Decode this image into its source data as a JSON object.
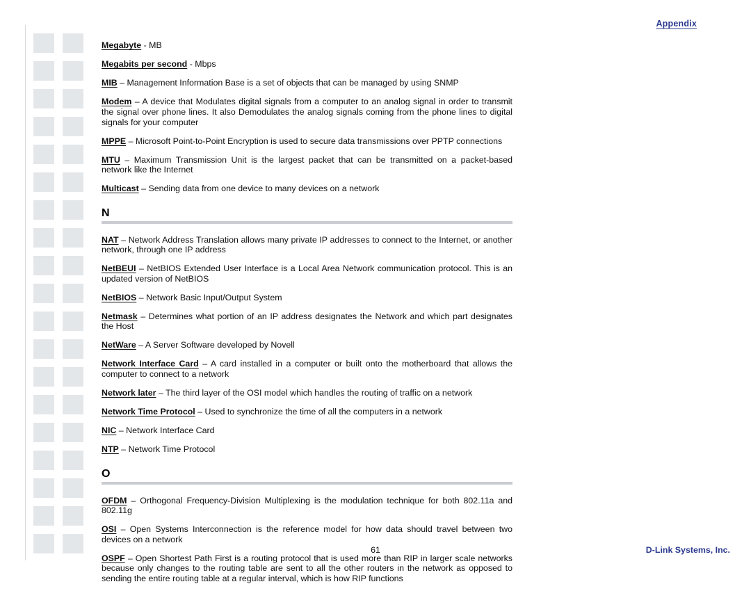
{
  "header": {
    "appendix_label": "Appendix"
  },
  "footer": {
    "page_number": "61",
    "brand": "D-Link Systems, Inc."
  },
  "decor": {
    "square_color": "#e4e7ea",
    "rule_color": "#c9ccd0",
    "accent_color": "#2b3a8f",
    "square_rows": 19
  },
  "glossary": {
    "entries_top": [
      {
        "term": "Megabyte",
        "definition": " - MB"
      },
      {
        "term": "Megabits per second",
        "definition": " - Mbps"
      },
      {
        "term": "MIB",
        "definition": " – Management Information Base is a set of objects that can be managed by using SNMP"
      },
      {
        "term": "Modem",
        "definition": " – A device that Modulates digital signals from a computer to an analog signal in order to transmit the signal over phone lines.  It also Demodulates the analog signals coming from the phone lines to digital signals for your computer"
      },
      {
        "term": "MPPE",
        "definition": " – Microsoft Point-to-Point Encryption is used to secure data transmissions over PPTP connections"
      },
      {
        "term": "MTU",
        "definition": " – Maximum Transmission Unit is the largest packet that can be transmitted on a packet-based network like the Internet"
      },
      {
        "term": "Multicast",
        "definition": " – Sending data from one device to many devices on a network"
      }
    ],
    "section_n": {
      "letter": "N",
      "entries": [
        {
          "term": "NAT",
          "definition": " – Network Address Translation allows many private IP addresses to connect to the Internet, or another network, through one IP address"
        },
        {
          "term": "NetBEUI",
          "definition": " – NetBIOS Extended User Interface is a Local Area Network communication protocol.  This is an updated version of NetBIOS"
        },
        {
          "term": "NetBIOS",
          "definition": " – Network Basic Input/Output System"
        },
        {
          "term": "Netmask",
          "definition": " – Determines what portion of an IP address designates the Network and which part designates the Host"
        },
        {
          "term": "NetWare",
          "definition": " – A Server Software developed by Novell"
        },
        {
          "term": "Network Interface Card",
          "definition": " – A card installed in a computer or built onto the motherboard that allows the computer to connect to a network"
        },
        {
          "term": "Network later",
          "definition": " – The third layer of the OSI model which handles the routing of traffic on a network"
        },
        {
          "term": "Network Time Protocol",
          "definition": " – Used to synchronize the time of all the computers in a network"
        },
        {
          "term": "NIC",
          "definition": " – Network Interface Card"
        },
        {
          "term": "NTP",
          "definition": " – Network Time Protocol"
        }
      ]
    },
    "section_o": {
      "letter": "O",
      "entries": [
        {
          "term": "OFDM",
          "definition": " – Orthogonal Frequency-Division Multiplexing is the modulation technique for both 802.11a and 802.11g"
        },
        {
          "term": "OSI",
          "definition": " – Open Systems Interconnection is the reference model for how data should travel between two devices on a network"
        },
        {
          "term": "OSPF",
          "definition": " – Open Shortest Path First is a routing protocol that is used more than RIP in larger scale networks because only changes to the routing table are sent to all the other routers in the network as opposed to sending the entire routing table at a regular interval, which is how RIP functions"
        }
      ]
    }
  }
}
